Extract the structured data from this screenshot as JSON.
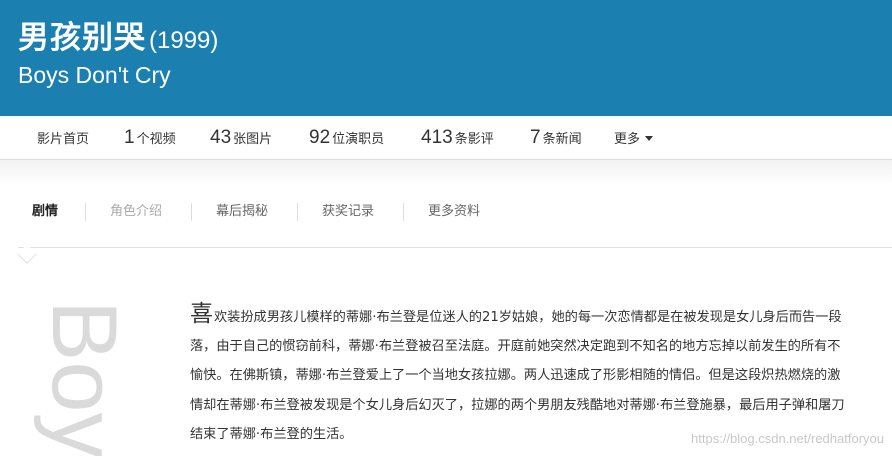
{
  "header": {
    "cn_title": "男孩别哭",
    "year": "(1999)",
    "en_title": "Boys Don't Cry",
    "background_color": "#1b7fb0"
  },
  "topnav": {
    "home": "影片首页",
    "videos": {
      "num": "1",
      "label": "个视频"
    },
    "photos": {
      "num": "43",
      "label": "张图片"
    },
    "cast": {
      "num": "92",
      "label": "位演职员"
    },
    "reviews": {
      "num": "413",
      "label": "条影评"
    },
    "news": {
      "num": "7",
      "label": "条新闻"
    },
    "more": "更多"
  },
  "subtabs": [
    "剧情",
    "角色介绍",
    "幕后揭秘",
    "获奖记录",
    "更多资料"
  ],
  "content": {
    "side_word": "Boy",
    "plot_first_char": "喜",
    "plot_rest": "欢装扮成男孩儿模样的蒂娜·布兰登是位迷人的21岁姑娘，她的每一次恋情都是在被发现是女儿身后而告一段落，由于自己的惯窃前科，蒂娜·布兰登被召至法庭。开庭前她突然决定跑到不知名的地方忘掉以前发生的所有不愉快。在佛斯镇，蒂娜·布兰登爱上了一个当地女孩拉娜。两人迅速成了形影相随的情侣。但是这段炽热燃烧的激情却在蒂娜·布兰登被发现是个女儿身后幻灭了，拉娜的两个男朋友残酷地对蒂娜·布兰登施暴，最后用子弹和屠刀结束了蒂娜·布兰登的生活。"
  },
  "watermark": "https://blog.csdn.net/redhatforyou"
}
